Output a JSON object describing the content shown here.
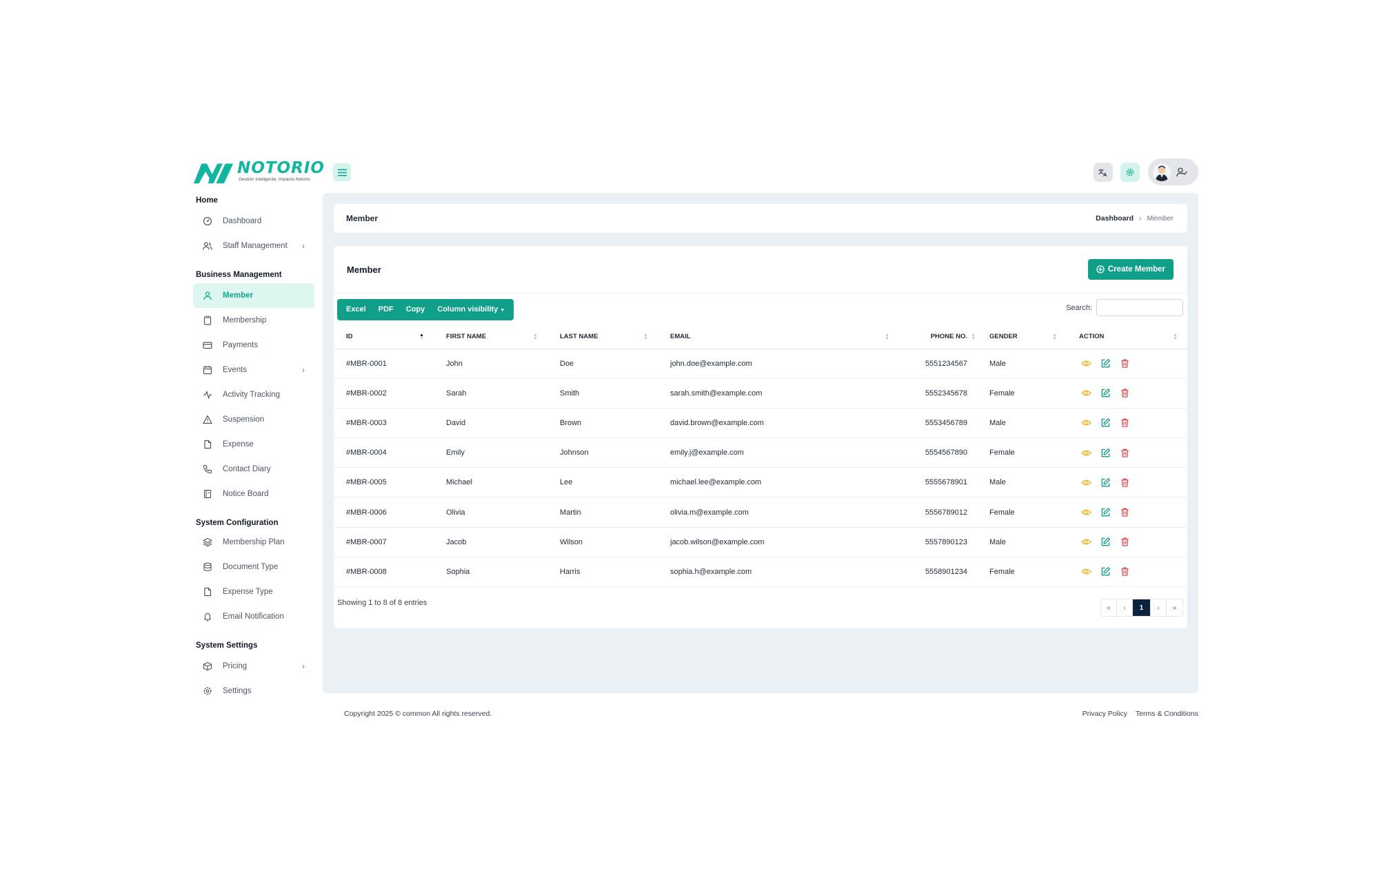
{
  "brand": {
    "name": "NOTORIO",
    "tagline": "Gestión Inteligente, Impacto Notorio",
    "accent": "#12b5a0"
  },
  "sidebar": {
    "sections": [
      {
        "title": "Home",
        "items": [
          {
            "label": "Dashboard",
            "icon": "gauge-icon"
          },
          {
            "label": "Staff Management",
            "icon": "users-icon",
            "expandable": true
          }
        ]
      },
      {
        "title": "Business Management",
        "items": [
          {
            "label": "Member",
            "icon": "user-icon",
            "active": true
          },
          {
            "label": "Membership",
            "icon": "clipboard-icon"
          },
          {
            "label": "Payments",
            "icon": "credit-card-icon"
          },
          {
            "label": "Events",
            "icon": "calendar-icon",
            "expandable": true
          },
          {
            "label": "Activity Tracking",
            "icon": "activity-icon"
          },
          {
            "label": "Suspension",
            "icon": "warning-icon"
          },
          {
            "label": "Expense",
            "icon": "file-icon"
          },
          {
            "label": "Contact Diary",
            "icon": "phone-icon"
          },
          {
            "label": "Notice Board",
            "icon": "notebook-icon"
          }
        ]
      },
      {
        "title": "System Configuration",
        "items": [
          {
            "label": "Membership Plan",
            "icon": "layers-icon"
          },
          {
            "label": "Document Type",
            "icon": "database-icon"
          },
          {
            "label": "Expense Type",
            "icon": "file-icon"
          },
          {
            "label": "Email Notification",
            "icon": "bell-icon"
          }
        ]
      },
      {
        "title": "System Settings",
        "items": [
          {
            "label": "Pricing",
            "icon": "box-icon",
            "expandable": true
          },
          {
            "label": "Settings",
            "icon": "gear-icon"
          }
        ]
      }
    ]
  },
  "breadcrumb": {
    "title": "Member",
    "home": "Dashboard",
    "current": "Member"
  },
  "card": {
    "title": "Member",
    "create_label": "Create Member"
  },
  "toolbar": {
    "buttons": [
      "Excel",
      "PDF",
      "Copy",
      "Column visibility"
    ]
  },
  "search": {
    "label": "Search:",
    "value": ""
  },
  "table": {
    "columns": [
      "ID",
      "FIRST NAME",
      "LAST NAME",
      "EMAIL",
      "PHONE NO.",
      "GENDER",
      "ACTION"
    ],
    "rows": [
      {
        "id": "#MBR-0001",
        "first": "John",
        "last": "Doe",
        "email": "john.doe@example.com",
        "phone": "5551234567",
        "gender": "Male"
      },
      {
        "id": "#MBR-0002",
        "first": "Sarah",
        "last": "Smith",
        "email": "sarah.smith@example.com",
        "phone": "5552345678",
        "gender": "Female"
      },
      {
        "id": "#MBR-0003",
        "first": "David",
        "last": "Brown",
        "email": "david.brown@example.com",
        "phone": "5553456789",
        "gender": "Male"
      },
      {
        "id": "#MBR-0004",
        "first": "Emily",
        "last": "Johnson",
        "email": "emily.j@example.com",
        "phone": "5554567890",
        "gender": "Female"
      },
      {
        "id": "#MBR-0005",
        "first": "Michael",
        "last": "Lee",
        "email": "michael.lee@example.com",
        "phone": "5555678901",
        "gender": "Male"
      },
      {
        "id": "#MBR-0006",
        "first": "Olivia",
        "last": "Martin",
        "email": "olivia.m@example.com",
        "phone": "5556789012",
        "gender": "Female"
      },
      {
        "id": "#MBR-0007",
        "first": "Jacob",
        "last": "Wilson",
        "email": "jacob.wilson@example.com",
        "phone": "5557890123",
        "gender": "Male"
      },
      {
        "id": "#MBR-0008",
        "first": "Sophia",
        "last": "Harris",
        "email": "sophia.h@example.com",
        "phone": "5558901234",
        "gender": "Female"
      }
    ]
  },
  "table_info": "Showing 1 to 8 of 8 entries",
  "pagination": {
    "first": "«",
    "prev": "‹",
    "current": "1",
    "next": "›",
    "last": "»"
  },
  "footer": {
    "copyright": "Copyright 2025 © common All rights reserved.",
    "links": [
      "Privacy Policy",
      "Terms & Conditions"
    ]
  },
  "colors": {
    "primary": "#10a08a",
    "view": "#f5b731",
    "edit": "#10a08a",
    "delete": "#e5484d",
    "page_active": "#0c2340"
  }
}
